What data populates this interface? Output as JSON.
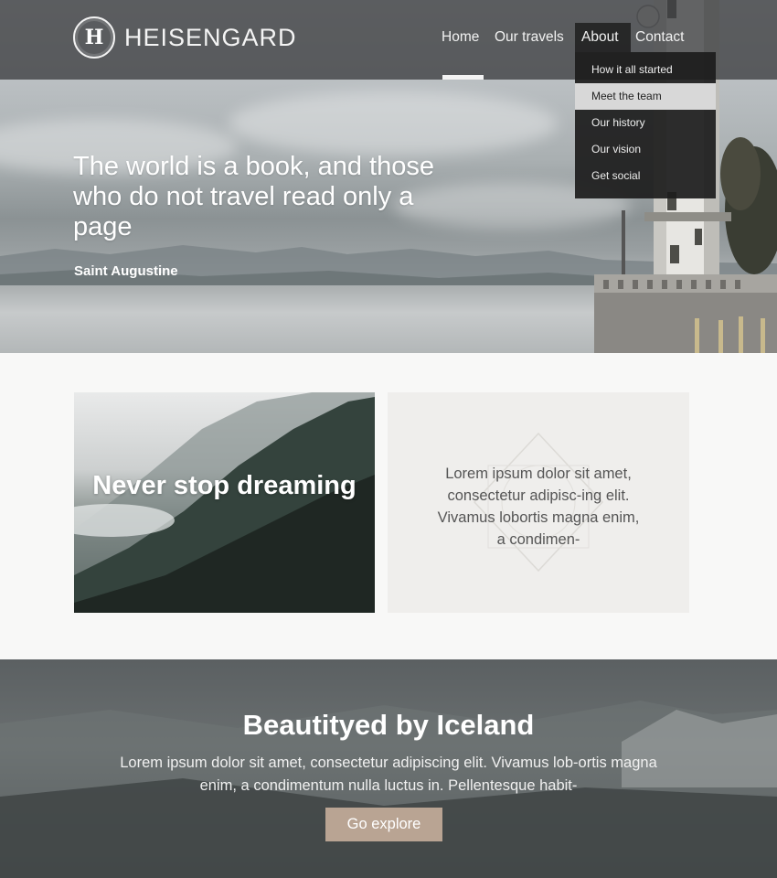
{
  "brand": {
    "logo_letter": "H",
    "name": "HEISENGARD"
  },
  "nav": {
    "items": [
      {
        "label": "Home"
      },
      {
        "label": "Our travels"
      },
      {
        "label": "About"
      },
      {
        "label": "Contact"
      }
    ],
    "active": "Home",
    "open_dropdown": "About"
  },
  "dropdown": {
    "items": [
      {
        "label": "How it all started"
      },
      {
        "label": "Meet the team"
      },
      {
        "label": "Our history"
      },
      {
        "label": "Our vision"
      },
      {
        "label": "Get social"
      }
    ],
    "highlighted": "Meet the team"
  },
  "hero": {
    "quote": "The world is a book, and those who do not travel read only a page",
    "author": "Saint Augustine"
  },
  "features": {
    "image_card_title": "Never stop dreaming",
    "text_card_body": "Lorem ipsum dolor sit amet, consectetur adipisc-ing elit. Vivamus lobortis magna enim, a condimen-"
  },
  "banner": {
    "title": "Beautityed by Iceland",
    "text": "Lorem ipsum dolor sit amet, consectetur adipiscing elit. Vivamus lob-ortis magna enim, a condimentum nulla luctus in. Pellentesque habit-",
    "button_label": "Go explore"
  },
  "colors": {
    "header_bg": "#3c3e40",
    "dropdown_bg": "#1c1c1c",
    "dropdown_highlight": "#d8d8d8",
    "button_accent": "#b9a493",
    "page_bg": "#f8f8f7",
    "text_card_bg": "#efeeec"
  }
}
